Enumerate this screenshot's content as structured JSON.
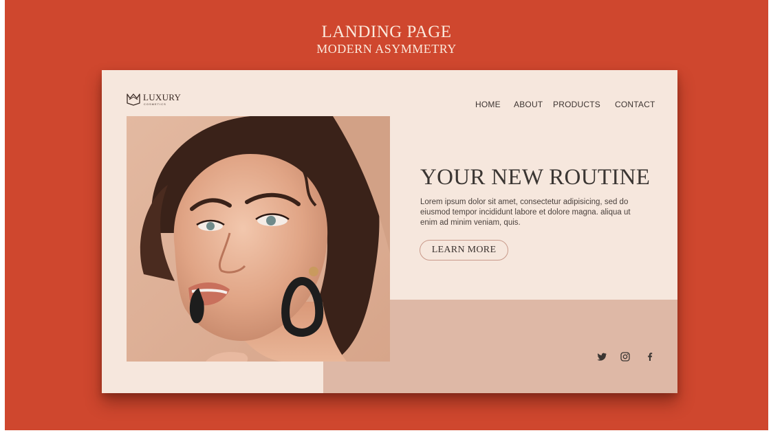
{
  "banner": {
    "title": "LANDING PAGE",
    "subtitle": "MODERN ASYMMETRY"
  },
  "brand": {
    "name": "LUXURY",
    "tagline": "COSMETICS",
    "icon": "crown-icon"
  },
  "nav": {
    "items": [
      {
        "label": "HOME"
      },
      {
        "label": "ABOUT"
      },
      {
        "label": "PRODUCTS"
      },
      {
        "label": "CONTACT"
      }
    ]
  },
  "hero": {
    "title": "YOUR NEW ROUTINE",
    "body": "Lorem ipsum dolor sit amet, consectetur adipisicing, sed do eiusmod tempor incididunt labore et dolore magna. aliqua ut enim ad minim veniam, quis.",
    "cta_label": "LEARN MORE"
  },
  "social": {
    "icons": [
      "twitter-icon",
      "instagram-icon",
      "facebook-icon"
    ]
  },
  "colors": {
    "background": "#cf472e",
    "card": "#f6e7dd",
    "accent_block": "#deb8a6",
    "text_dark": "#3b3633",
    "banner_text": "#fbe9dc"
  }
}
